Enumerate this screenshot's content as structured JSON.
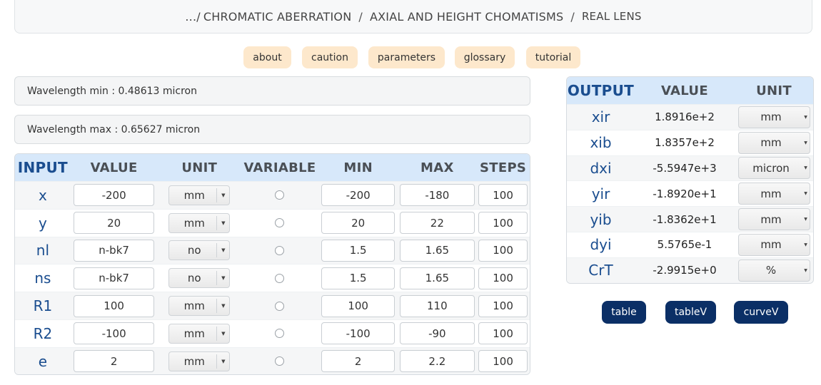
{
  "breadcrumb": {
    "prefix": ".../",
    "crumb1": "CHROMATIC ABERRATION",
    "separator": "/",
    "crumb2": "AXIAL AND HEIGHT CHOMATISMS",
    "crumb3": "REAL LENS"
  },
  "nav_buttons": [
    "about",
    "caution",
    "parameters",
    "glossary",
    "tutorial"
  ],
  "wavelength_min": "Wavelength min : 0.48613 micron",
  "wavelength_max": "Wavelength max : 0.65627 micron",
  "input_table": {
    "headers": [
      "INPUT",
      "VALUE",
      "UNIT",
      "VARIABLE",
      "MIN",
      "MAX",
      "STEPS"
    ],
    "rows": [
      {
        "name": "x",
        "value": "-200",
        "unit": "mm",
        "min": "-200",
        "max": "-180",
        "steps": "100"
      },
      {
        "name": "y",
        "value": "20",
        "unit": "mm",
        "min": "20",
        "max": "22",
        "steps": "100"
      },
      {
        "name": "nl",
        "value": "n-bk7",
        "unit": "no",
        "min": "1.5",
        "max": "1.65",
        "steps": "100"
      },
      {
        "name": "ns",
        "value": "n-bk7",
        "unit": "no",
        "min": "1.5",
        "max": "1.65",
        "steps": "100"
      },
      {
        "name": "R1",
        "value": "100",
        "unit": "mm",
        "min": "100",
        "max": "110",
        "steps": "100"
      },
      {
        "name": "R2",
        "value": "-100",
        "unit": "mm",
        "min": "-100",
        "max": "-90",
        "steps": "100"
      },
      {
        "name": "e",
        "value": "2",
        "unit": "mm",
        "min": "2",
        "max": "2.2",
        "steps": "100"
      }
    ]
  },
  "output_table": {
    "headers": [
      "OUTPUT",
      "VALUE",
      "UNIT"
    ],
    "rows": [
      {
        "name": "xir",
        "value": "1.8916e+2",
        "unit": "mm"
      },
      {
        "name": "xib",
        "value": "1.8357e+2",
        "unit": "mm"
      },
      {
        "name": "dxi",
        "value": "-5.5947e+3",
        "unit": "micron"
      },
      {
        "name": "yir",
        "value": "-1.8920e+1",
        "unit": "mm"
      },
      {
        "name": "yib",
        "value": "-1.8362e+1",
        "unit": "mm"
      },
      {
        "name": "dyi",
        "value": "5.5765e-1",
        "unit": "mm"
      },
      {
        "name": "CrT",
        "value": "-2.9915e+0",
        "unit": "%"
      }
    ]
  },
  "action_buttons": [
    "table",
    "tableV",
    "curveV"
  ],
  "colors": {
    "header_bg": "#d7e8fa",
    "pill_bg": "#fde8cc",
    "dark_button": "#0b2f66",
    "param_name": "#1a4d8f"
  }
}
